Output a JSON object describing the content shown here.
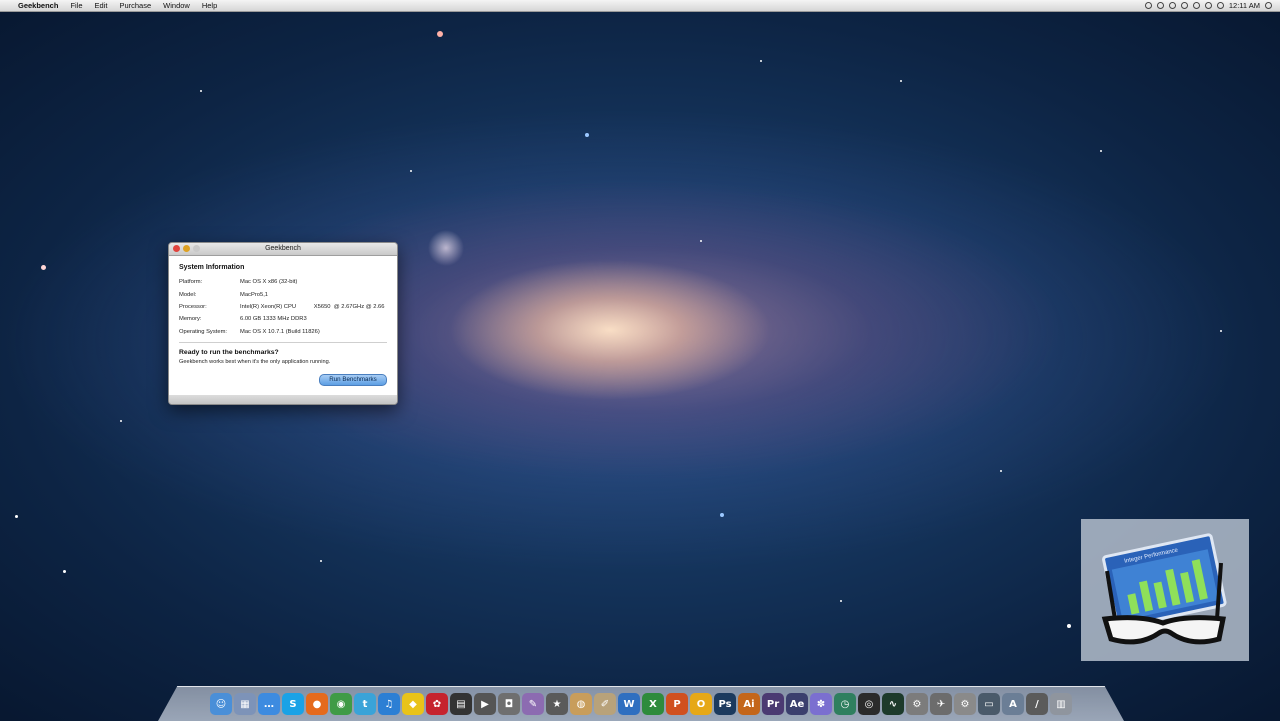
{
  "menubar": {
    "app_name": "Geekbench",
    "menus": [
      "File",
      "Edit",
      "Purchase",
      "Window",
      "Help"
    ],
    "clock": "12:11 AM",
    "status_icons": [
      "dropbox-icon",
      "clock-icon",
      "sync-icon",
      "bluetooth-icon",
      "wifi-icon",
      "volume-icon",
      "battery-icon",
      "user-icon"
    ]
  },
  "window": {
    "title": "Geekbench",
    "system_info_title": "System Information",
    "rows": [
      {
        "label": "Platform:",
        "value": "Mac OS X x86 (32-bit)"
      },
      {
        "label": "Model:",
        "value": "MacPro5,1"
      },
      {
        "label": "Processor:",
        "value": "Intel(R) Xeon(R) CPU           X5650  @ 2.67GHz @ 2.66"
      },
      {
        "label": "Memory:",
        "value": "6.00 GB 1333 MHz DDR3"
      },
      {
        "label": "Operating System:",
        "value": "Mac OS X 10.7.1 (Build 11826)"
      }
    ],
    "ready_title": "Ready to run the benchmarks?",
    "ready_subtitle": "Geekbench works best when it's the only application running.",
    "run_button": "Run Benchmarks"
  },
  "overlay_icon": {
    "name": "geekbench-app-icon",
    "chart_text": "Integer Performance"
  },
  "dock": {
    "items": [
      {
        "name": "finder-icon",
        "glyph": "☺",
        "color": "#4a8fd8"
      },
      {
        "name": "preview-icon",
        "glyph": "▦",
        "color": "#7d93b8"
      },
      {
        "name": "ichat-icon",
        "glyph": "…",
        "color": "#3d8be0"
      },
      {
        "name": "skype-icon",
        "glyph": "S",
        "color": "#1aa2e6"
      },
      {
        "name": "firefox-icon",
        "glyph": "●",
        "color": "#e56a1c"
      },
      {
        "name": "chrome-icon",
        "glyph": "◉",
        "color": "#3f9b46"
      },
      {
        "name": "twitter-icon",
        "glyph": "t",
        "color": "#3aa3d8"
      },
      {
        "name": "itunes-icon",
        "glyph": "♫",
        "color": "#2c7fd4"
      },
      {
        "name": "adium-icon",
        "glyph": "◆",
        "color": "#e9c319"
      },
      {
        "name": "tweetdeck-icon",
        "glyph": "✿",
        "color": "#c6232e"
      },
      {
        "name": "clapper-icon",
        "glyph": "▤",
        "color": "#333333"
      },
      {
        "name": "final-cut-icon",
        "glyph": "▶",
        "color": "#555555"
      },
      {
        "name": "photo-booth-icon",
        "glyph": "◘",
        "color": "#6f6f6f"
      },
      {
        "name": "ical-icon",
        "glyph": "✎",
        "color": "#8c6bb1"
      },
      {
        "name": "imovie-icon",
        "glyph": "★",
        "color": "#5a5a5a"
      },
      {
        "name": "cake-icon",
        "glyph": "◍",
        "color": "#c89d5b"
      },
      {
        "name": "pages-icon",
        "glyph": "✐",
        "color": "#b8a27a"
      },
      {
        "name": "word-icon",
        "glyph": "W",
        "color": "#2f6fc0"
      },
      {
        "name": "excel-icon",
        "glyph": "X",
        "color": "#2e8b3c"
      },
      {
        "name": "powerpoint-icon",
        "glyph": "P",
        "color": "#d0501f"
      },
      {
        "name": "outlook-icon",
        "glyph": "O",
        "color": "#e6a817"
      },
      {
        "name": "photoshop-icon",
        "glyph": "Ps",
        "color": "#1c3a5e"
      },
      {
        "name": "illustrator-icon",
        "glyph": "Ai",
        "color": "#c4661a"
      },
      {
        "name": "premiere-icon",
        "glyph": "Pr",
        "color": "#4b3a72"
      },
      {
        "name": "after-effects-icon",
        "glyph": "Ae",
        "color": "#3b3f6d"
      },
      {
        "name": "iphoto-icon",
        "glyph": "✽",
        "color": "#7b6fd0"
      },
      {
        "name": "time-machine-icon",
        "glyph": "◷",
        "color": "#2f7f5f"
      },
      {
        "name": "camera-icon",
        "glyph": "◎",
        "color": "#2b2b2b"
      },
      {
        "name": "activity-monitor-icon",
        "glyph": "∿",
        "color": "#1d3a2a"
      },
      {
        "name": "system-prefs-icon",
        "glyph": "⚙",
        "color": "#7c7c7c"
      },
      {
        "name": "utility-icon",
        "glyph": "✈",
        "color": "#6c6c6c"
      },
      {
        "name": "settings-icon",
        "glyph": "⚙",
        "color": "#8a8a8a"
      },
      {
        "name": "console-icon",
        "glyph": "▭",
        "color": "#4a5a6a"
      },
      {
        "name": "applications-folder-icon",
        "glyph": "A",
        "color": "#6b7e96"
      },
      {
        "name": "documents-folder-icon",
        "glyph": "/",
        "color": "#5b5b5b"
      },
      {
        "name": "trash-icon",
        "glyph": "▥",
        "color": "#8f959e"
      }
    ]
  }
}
